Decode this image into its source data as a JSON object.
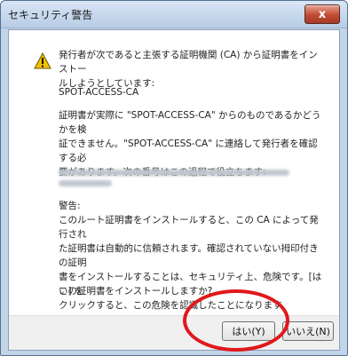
{
  "window": {
    "title": "セキュリティ警告",
    "close_label": "x"
  },
  "message": {
    "p1": "発行者が次であると主張する証明機関 (CA) から証明書をインストー\nルしようとしています:",
    "ca_name": "SPOT-ACCESS-CA",
    "p2": "証明書が実際に \"SPOT-ACCESS-CA\" からのものであるかどうかを検\n証できません。\"SPOT-ACCESS-CA\" に連絡して発行者を確認する必\n要があります。次の番号はこの過程で役立ちます:",
    "warning_heading": "警告:",
    "warning_body": "このルート証明書をインストールすると、この CA によって発行され\nた証明書は自動的に信頼されます。確認されていない拇印付きの証明\n書をインストールすることは、セキュリティ上、危険です。[はい] を\nクリックすると、この危険を認識したことになります。",
    "question": "この証明書をインストールしますか?"
  },
  "buttons": {
    "yes_label": "はい(Y)",
    "no_label": "いいえ(N)"
  },
  "colors": {
    "annotation_circle": "#e0191c",
    "close_button": "#c24b35",
    "warning_icon": "#f2c200"
  }
}
